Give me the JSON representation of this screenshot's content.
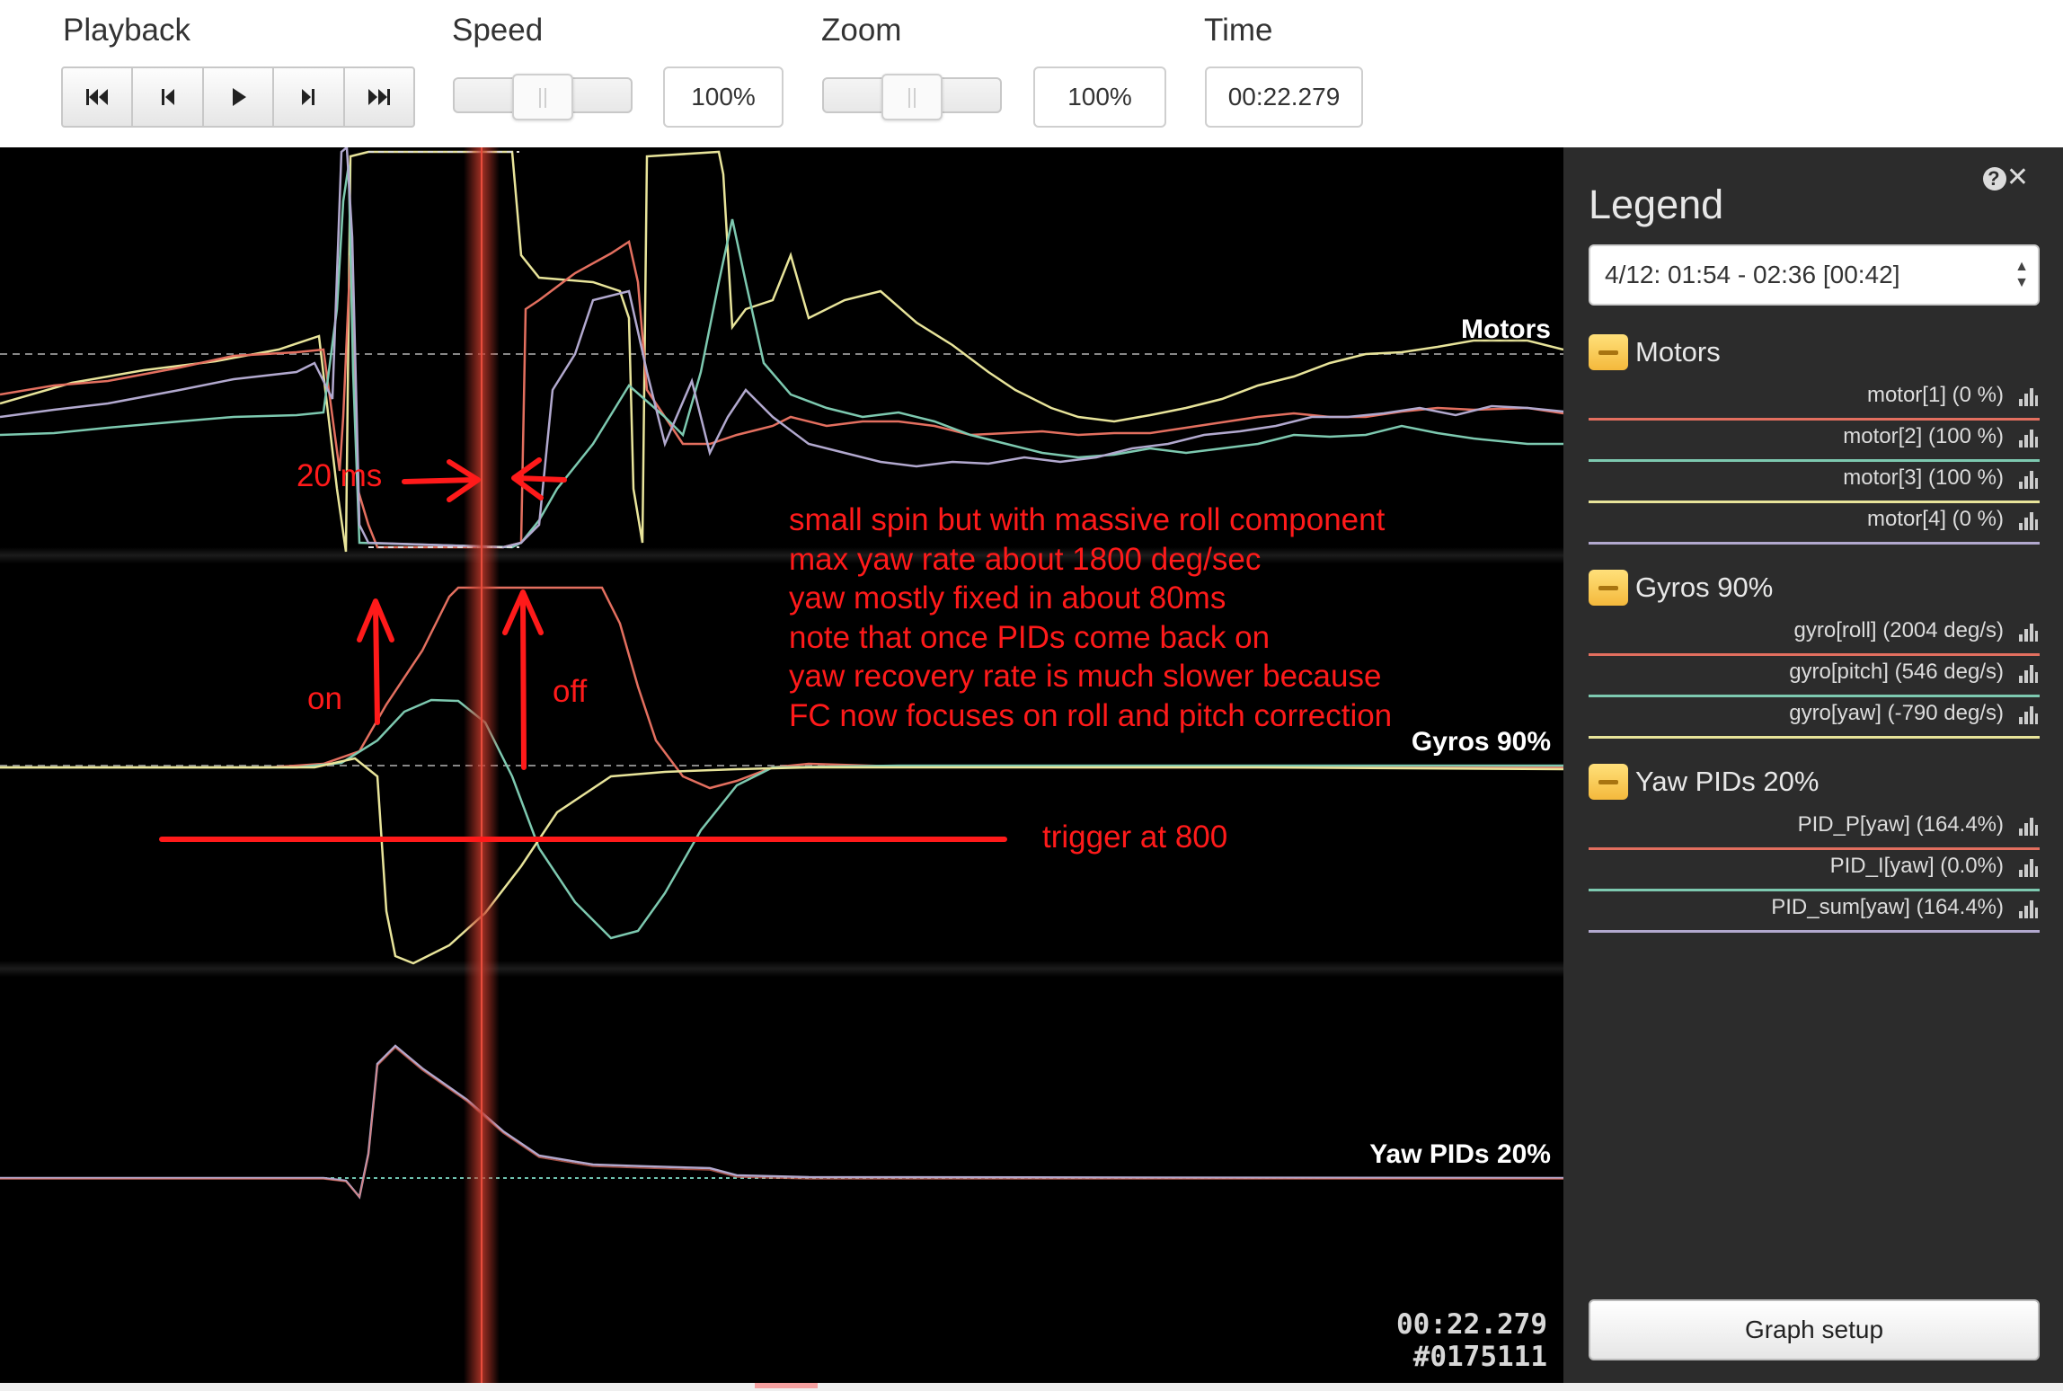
{
  "toolbar": {
    "playback_label": "Playback",
    "speed_label": "Speed",
    "speed_value": "100%",
    "speed_slider_level": 0.5,
    "zoom_label": "Zoom",
    "zoom_value": "100%",
    "zoom_slider_level": 0.5,
    "time_label": "Time",
    "time_value": "00:22.279",
    "buttons": [
      "skip-to-start-icon",
      "step-back-icon",
      "play-icon",
      "step-forward-icon",
      "skip-to-end-icon"
    ]
  },
  "graph": {
    "groups": [
      "Motors",
      "Gyros 90%",
      "Yaw PIDs 20%"
    ],
    "readout_time": "00:22.279",
    "readout_frame": "#0175111",
    "annotations": {
      "span": "20 ms",
      "on": "on",
      "off": "off",
      "trigger": "trigger at 800",
      "notes": [
        "small spin but with massive roll component",
        "max yaw rate about 1800 deg/sec",
        "yaw mostly fixed in about 80ms",
        "note that once PIDs come back on",
        "yaw recovery rate is much slower because",
        "FC now focuses on roll and pitch correction"
      ]
    }
  },
  "legend": {
    "title": "Legend",
    "log_select": "4/12: 01:54 - 02:36 [00:42]",
    "groups": [
      {
        "name": "Motors",
        "series": [
          {
            "label": "motor[1] (0 %)",
            "color": "#e36f5f"
          },
          {
            "label": "motor[2] (100 %)",
            "color": "#7dc9b0"
          },
          {
            "label": "motor[3] (100 %)",
            "color": "#e8e49a"
          },
          {
            "label": "motor[4] (0 %)",
            "color": "#b2a9cf"
          }
        ]
      },
      {
        "name": "Gyros 90%",
        "series": [
          {
            "label": "gyro[roll] (2004 deg/s)",
            "color": "#e36f5f"
          },
          {
            "label": "gyro[pitch] (546 deg/s)",
            "color": "#7dc9b0"
          },
          {
            "label": "gyro[yaw] (-790 deg/s)",
            "color": "#e8e49a"
          }
        ]
      },
      {
        "name": "Yaw PIDs 20%",
        "series": [
          {
            "label": "PID_P[yaw] (164.4%)",
            "color": "#e36f5f"
          },
          {
            "label": "PID_I[yaw] (0.0%)",
            "color": "#7dc9b0"
          },
          {
            "label": "PID_sum[yaw] (164.4%)",
            "color": "#b2a9cf"
          }
        ]
      }
    ],
    "graph_setup_label": "Graph setup"
  },
  "colors": {
    "accent_annotation": "#ff1a1a",
    "cursor": "#c0392b",
    "legend_bg": "#2c2c2c",
    "group_toggle": "#f4b93c"
  }
}
